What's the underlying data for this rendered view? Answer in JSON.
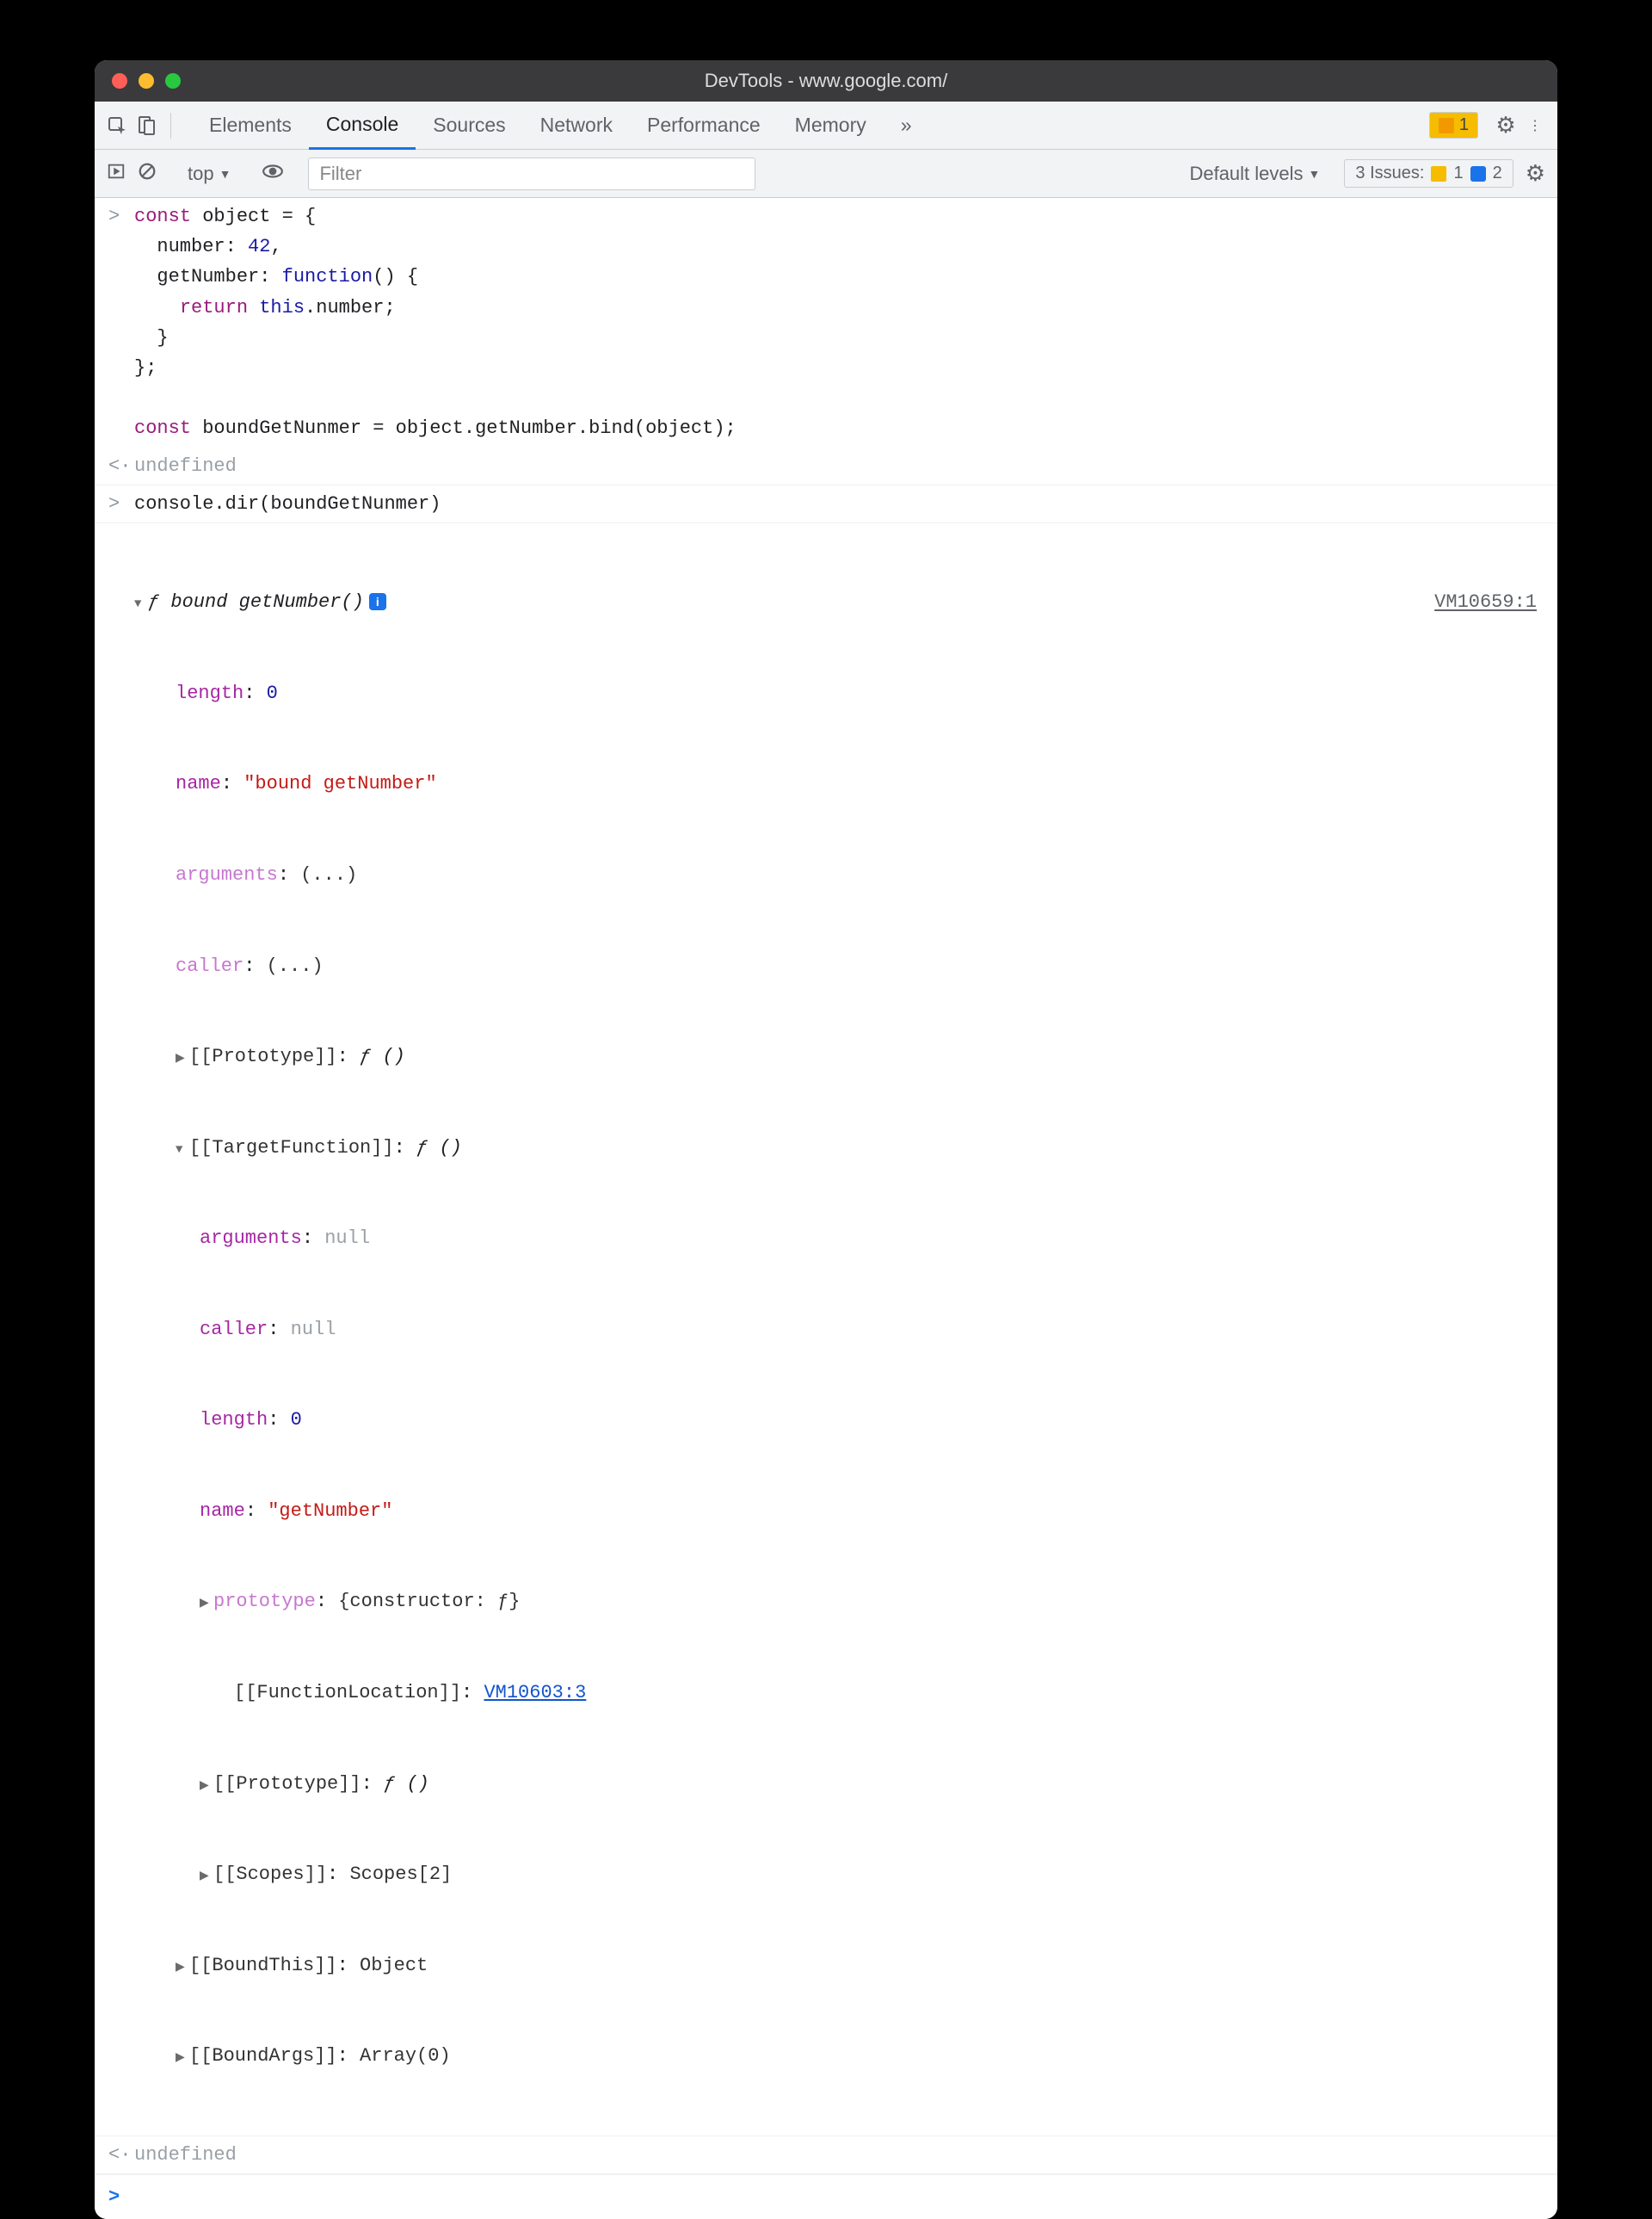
{
  "title": "DevTools - www.google.com/",
  "tabs": [
    "Elements",
    "Console",
    "Sources",
    "Network",
    "Performance",
    "Memory"
  ],
  "activeTab": "Console",
  "warningCount": "1",
  "contextLabel": "top",
  "filterPlaceholder": "Filter",
  "levelsLabel": "Default levels",
  "issues": {
    "label": "3 Issues:",
    "warn": "1",
    "info": "2"
  },
  "code1": {
    "l1a": "const",
    "l1b": " object = {",
    "l2a": "  number: ",
    "l2b": "42",
    "l2c": ",",
    "l3a": "  getNumber: ",
    "l3b": "function",
    "l3c": "() {",
    "l4a": "    ",
    "l4b": "return",
    "l4c": " ",
    "l4d": "this",
    "l4e": ".number;",
    "l5": "  }",
    "l6": "};",
    "l7": "",
    "l8a": "const",
    "l8b": " boundGetNunmer = object.getNumber.bind(object);"
  },
  "result1": "undefined",
  "code2": "console.dir(boundGetNunmer)",
  "srcLink": "VM10659:1",
  "dir": {
    "header_fn": "ƒ bound getNumber()",
    "length_k": "length",
    "length_v": "0",
    "name_k": "name",
    "name_v": "\"bound getNumber\"",
    "args_k": "arguments",
    "args_v": "(...)",
    "caller_k": "caller",
    "caller_v": "(...)",
    "proto_k": "[[Prototype]]",
    "proto_v": "ƒ ()",
    "tf_k": "[[TargetFunction]]",
    "tf_v": "ƒ ()",
    "tf_args_k": "arguments",
    "tf_args_v": "null",
    "tf_caller_k": "caller",
    "tf_caller_v": "null",
    "tf_len_k": "length",
    "tf_len_v": "0",
    "tf_name_k": "name",
    "tf_name_v": "\"getNumber\"",
    "tf_proto_k": "prototype",
    "tf_proto_v": "{constructor: ƒ}",
    "tf_loc_k": "[[FunctionLocation]]",
    "tf_loc_v": "VM10603:3",
    "tf_pp_k": "[[Prototype]]",
    "tf_pp_v": "ƒ ()",
    "tf_sc_k": "[[Scopes]]",
    "tf_sc_v": "Scopes[2]",
    "bt_k": "[[BoundThis]]",
    "bt_v": "Object",
    "ba_k": "[[BoundArgs]]",
    "ba_v": "Array(0)"
  },
  "result2": "undefined"
}
